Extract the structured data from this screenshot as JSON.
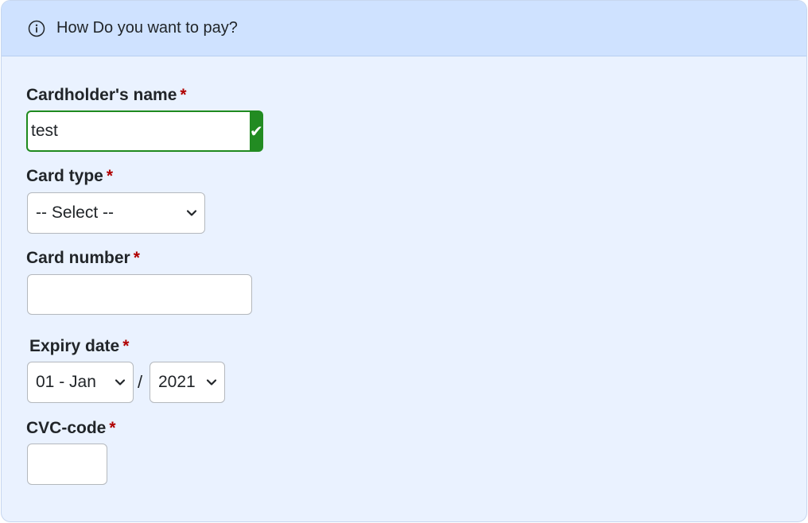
{
  "header": {
    "title": "How Do you want to pay?",
    "icon": "info-icon"
  },
  "form": {
    "cardholder": {
      "label": "Cardholder's name",
      "required_mark": "*",
      "value": "test",
      "status_icon": "checkmark-icon",
      "status_color": "#228b22"
    },
    "card_type": {
      "label": "Card type",
      "required_mark": "*",
      "selected": "-- Select --"
    },
    "card_number": {
      "label": "Card number",
      "required_mark": "*",
      "value": ""
    },
    "expiry": {
      "label": "Expiry date",
      "required_mark": "*",
      "month_selected": "01 - Jan",
      "separator": "/",
      "year_selected": "2021"
    },
    "cvc": {
      "label": "CVC-code",
      "required_mark": "*",
      "value": ""
    }
  },
  "colors": {
    "header_bg": "#cfe2ff",
    "panel_bg": "#eaf2ff",
    "required": "#b00000",
    "valid": "#228b22"
  }
}
